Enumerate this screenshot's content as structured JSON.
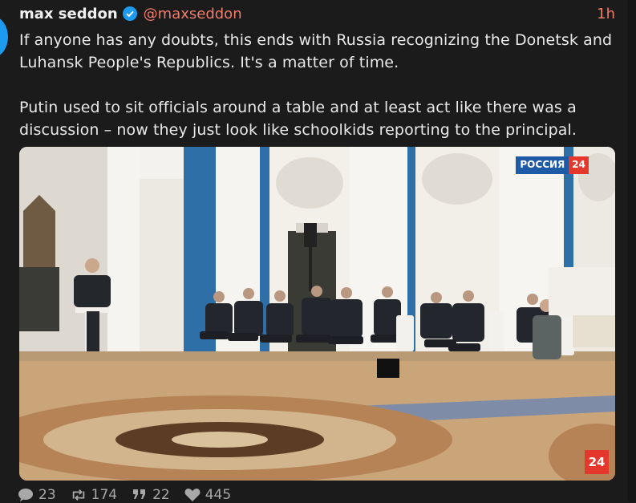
{
  "tweet": {
    "author_name": "max seddon",
    "handle": "@maxseddon",
    "time": "1h",
    "paragraphs": [
      "If anyone has any doubts, this ends with Russia recognizing the Donetsk and Luhansk People's Republics. It's a matter of time.",
      "Putin used to sit officials around a table and at least act like there was a discussion – now they just look like schoolkids reporting to the principal."
    ]
  },
  "media": {
    "channel_logo_text": "РОССИЯ",
    "channel_logo_number": "24",
    "corner_badge": "24"
  },
  "actions": {
    "replies": "23",
    "retweets": "174",
    "quotes": "22",
    "likes": "445"
  },
  "colors": {
    "accent": "#f27b6a",
    "verified": "#1d9bf0",
    "background": "#1b1b1b"
  }
}
